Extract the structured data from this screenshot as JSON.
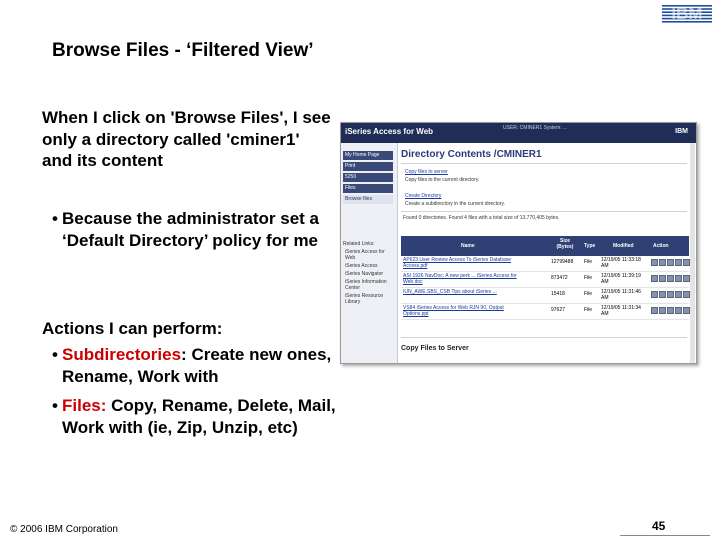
{
  "logo": {
    "text": "IBM"
  },
  "title": "Browse Files - ‘Filtered View’",
  "intro": {
    "text": "When I click on 'Browse Files', I see only a directory called 'cminer1' and its content",
    "bullet": "Because the administrator set a ‘Default Directory’ policy for me"
  },
  "actions": {
    "heading": "Actions I can perform:",
    "items": [
      {
        "label": "Subdirectories",
        "colon": ":",
        "text": " Create new ones, Rename, Work with"
      },
      {
        "label": "Files:",
        "colon": "",
        "text": " Copy, Rename, Delete, Mail, Work with (ie, Zip, Unzip, etc)"
      }
    ]
  },
  "footer": {
    "copyright": "© 2006 IBM Corporation",
    "page": "45"
  },
  "colors": {
    "accent_red": "#cc0000",
    "header_navy": "#1f2d57"
  },
  "screenshot": {
    "app_title": "iSeries Access for Web",
    "user_info": "USER: CMINER1   System: ...",
    "brand": "IBM",
    "nav": [
      "My Home Page",
      "Print",
      "5250",
      "Files",
      "Browse files"
    ],
    "related_heading": "Related Links:",
    "related_links": [
      "iSeries Access for Web",
      "iSeries Access",
      "iSeries Navigator",
      "iSeries Information Center",
      "iSeries Resource Library"
    ],
    "page_heading": "Directory Contents /CMINER1",
    "commands": [
      {
        "label": "Copy files to server",
        "link": true
      },
      {
        "label": "Copy files to the current directory.",
        "link": false
      },
      {
        "label": "Create Directory",
        "link": true
      },
      {
        "label": "Create a subdirectory in the current directory.",
        "link": false
      }
    ],
    "summary": "Found 0 directories. Found 4 files with a total size of 13,770,405 bytes.",
    "table": {
      "headers": {
        "name": "Name",
        "size": "Size (Bytes)",
        "type": "Type",
        "modified": "Modified",
        "action": "Action"
      },
      "rows": [
        {
          "name": "AP623 User Review Access To iSeries Database Access.pdf",
          "size": "12799488",
          "type": "File",
          "modified": "12/19/05 11:33:18 AM"
        },
        {
          "name": "ASI 1926 NavDoc: A new perk ... iSeries Access for Web.doc",
          "size": "873472",
          "type": "File",
          "modified": "12/19/05 11:39:19 AM"
        },
        {
          "name": "IUN_AWE.SBS_CSB Tips about iSeries ...",
          "size": "15418",
          "type": "File",
          "modified": "12/19/05 11:31:46 AM"
        },
        {
          "name": "VS84 iSeries Access for Web RJN 90, Output Options.ppt",
          "size": "97627",
          "type": "File",
          "modified": "12/19/05 11:31:34 AM"
        }
      ]
    },
    "copy_heading": "Copy Files to Server"
  }
}
